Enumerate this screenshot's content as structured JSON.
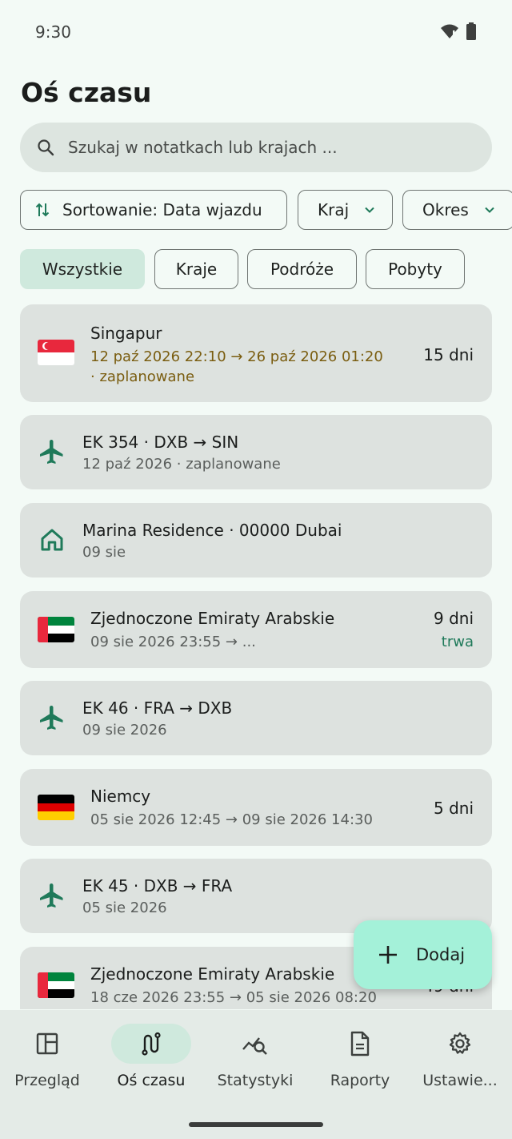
{
  "status": {
    "time": "9:30"
  },
  "page_title": "Oś czasu",
  "search": {
    "placeholder": "Szukaj w notatkach lub krajach ..."
  },
  "sort_chips": {
    "sort": "Sortowanie: Data wjazdu",
    "country": "Kraj",
    "period": "Okres"
  },
  "filters": [
    "Wszystkie",
    "Kraje",
    "Podróże",
    "Pobyty"
  ],
  "entries": [
    {
      "type": "stay",
      "flag": "singapore",
      "title": "Singapur",
      "dates": "12 paź 2026 22:10  →  26 paź 2026 01:20",
      "status": "· zaplanowane",
      "days": "15 dni"
    },
    {
      "type": "flight",
      "title": "EK 354 · DXB → SIN",
      "sub": "12 paź 2026 · zaplanowane"
    },
    {
      "type": "home",
      "title": "Marina Residence · 00000 Dubai",
      "sub": "09 sie"
    },
    {
      "type": "stay",
      "flag": "uae",
      "title": "Zjednoczone Emiraty Arabskie",
      "dates": "09 sie 2026 23:55  →  ...",
      "days": "9 dni",
      "status": "trwa"
    },
    {
      "type": "flight",
      "title": "EK 46 · FRA → DXB",
      "sub": "09 sie 2026"
    },
    {
      "type": "stay",
      "flag": "germany",
      "title": "Niemcy",
      "dates": "05 sie 2026 12:45  →  09 sie 2026 14:30",
      "days": "5 dni"
    },
    {
      "type": "flight",
      "title": "EK 45 · DXB → FRA",
      "sub": "05 sie 2026"
    },
    {
      "type": "stay",
      "flag": "uae",
      "title": "Zjednoczone Emiraty Arabskie",
      "dates": "18 cze 2026 23:55  →  05 sie 2026 08:20",
      "days": "49 dni"
    }
  ],
  "fab": {
    "label": "Dodaj",
    "icon": "plus-icon"
  },
  "nav": [
    {
      "label": "Przegląd",
      "icon": "dashboard-icon"
    },
    {
      "label": "Oś czasu",
      "icon": "timeline-icon",
      "active": true
    },
    {
      "label": "Statystyki",
      "icon": "stats-icon"
    },
    {
      "label": "Raporty",
      "icon": "report-icon"
    },
    {
      "label": "Ustawie...",
      "icon": "gear-icon"
    }
  ],
  "colors": {
    "accent": "#1f7a5a",
    "fab": "#a4f1d9",
    "active_chip": "#cfe9dd",
    "planned": "#7a5d10"
  }
}
